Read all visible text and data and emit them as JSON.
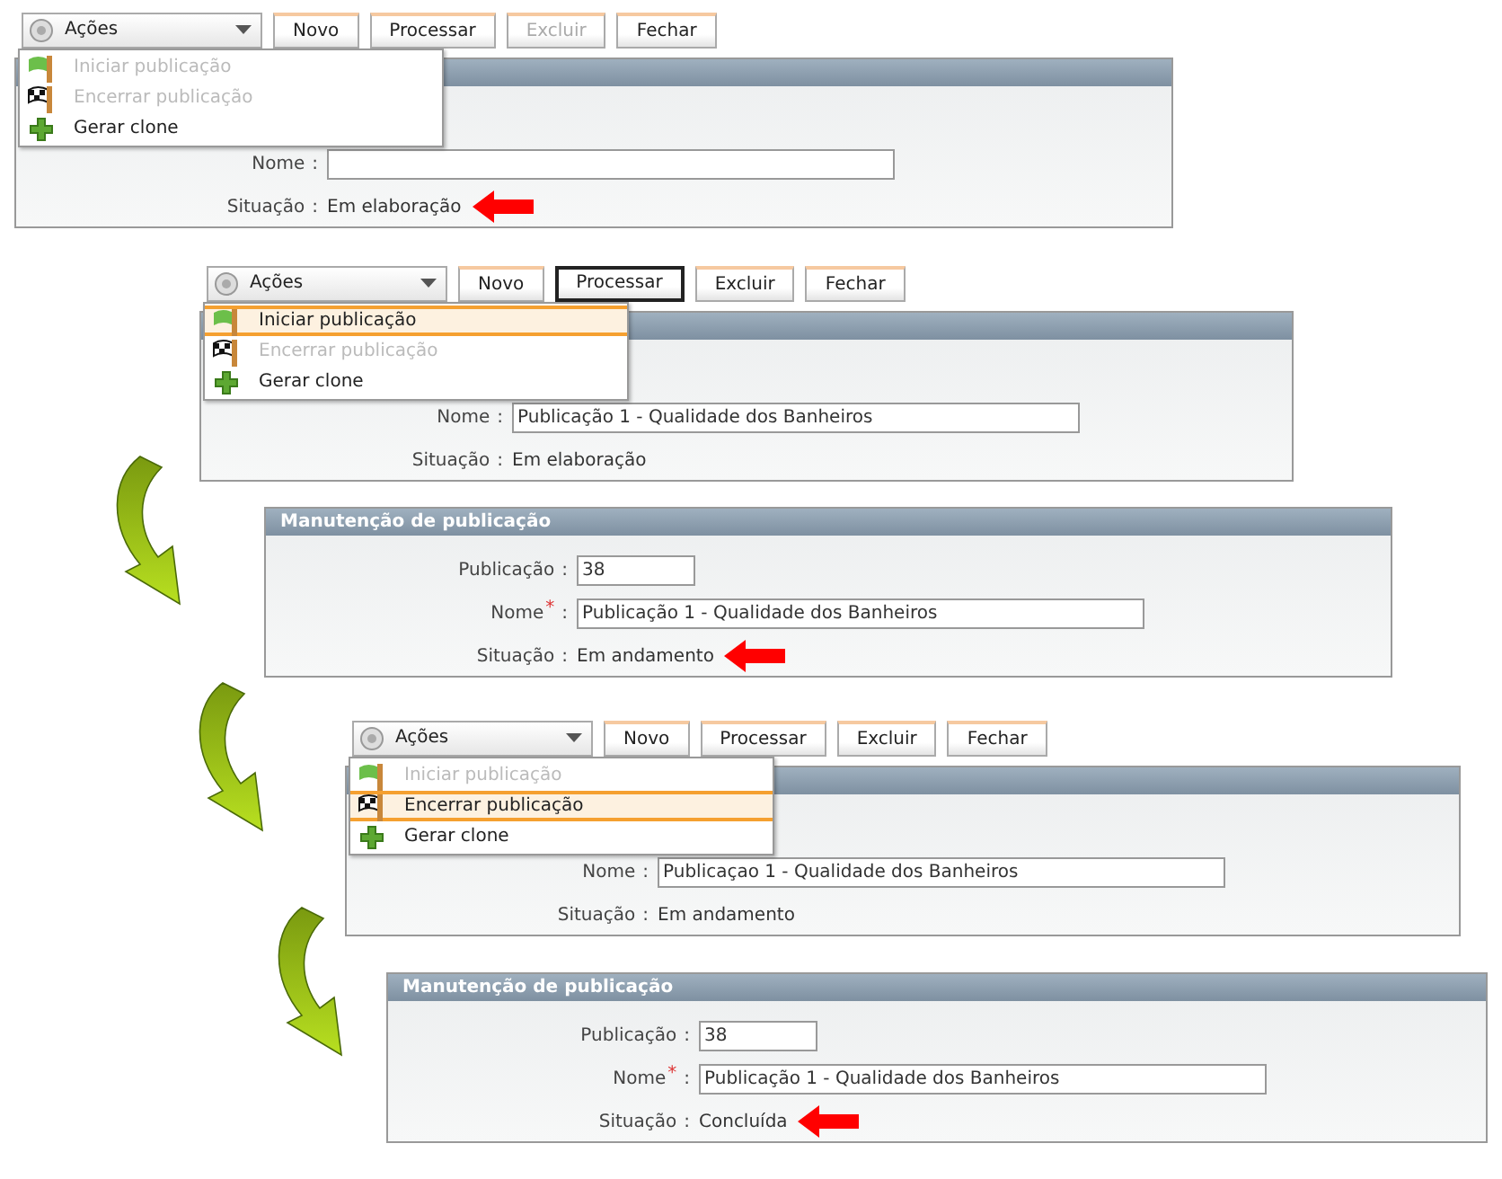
{
  "snippets": [
    {
      "kind": "actions",
      "toolbar": {
        "menu_label": "Ações",
        "buttons": [
          {
            "label": "Novo",
            "disabled": false,
            "focused": false
          },
          {
            "label": "Processar",
            "disabled": false,
            "focused": false
          },
          {
            "label": "Excluir",
            "disabled": true,
            "focused": false
          },
          {
            "label": "Fechar",
            "disabled": false,
            "focused": false
          }
        ],
        "menu": [
          {
            "kind": "start",
            "label": "Iniciar publicação",
            "disabled": true,
            "selected": false
          },
          {
            "kind": "finish",
            "label": "Encerrar publicação",
            "disabled": true,
            "selected": false
          },
          {
            "kind": "clone",
            "label": "Gerar clone",
            "disabled": false,
            "selected": false
          }
        ]
      },
      "panel": {
        "rows": [
          {
            "kind": "input",
            "label": "Nome",
            "colon": ":"
          },
          {
            "kind": "status",
            "label": "Situação",
            "colon": ":",
            "value": "Em elaboração"
          }
        ]
      },
      "highlight": true
    },
    {
      "kind": "actions",
      "toolbar": {
        "menu_label": "Ações",
        "buttons": [
          {
            "label": "Novo",
            "disabled": false,
            "focused": false
          },
          {
            "label": "Processar",
            "disabled": false,
            "focused": true
          },
          {
            "label": "Excluir",
            "disabled": false,
            "focused": false
          },
          {
            "label": "Fechar",
            "disabled": false,
            "focused": false
          }
        ],
        "menu": [
          {
            "kind": "start",
            "label": "Iniciar publicação",
            "disabled": false,
            "selected": true
          },
          {
            "kind": "finish",
            "label": "Encerrar publicação",
            "disabled": true,
            "selected": false
          },
          {
            "kind": "clone",
            "label": "Gerar clone",
            "disabled": false,
            "selected": false
          }
        ]
      },
      "panel": {
        "rows": [
          {
            "kind": "input",
            "label": "Nome",
            "colon": ":",
            "value": "Publicação 1 - Qualidade dos Banheiros"
          },
          {
            "kind": "status",
            "label": "Situação",
            "colon": ":",
            "value": "Em elaboração"
          }
        ]
      },
      "highlight": false
    },
    {
      "kind": "form",
      "panel": {
        "title": "Manutenção de publicação",
        "rows": [
          {
            "kind": "short-input",
            "label": "Publicação",
            "colon": ":",
            "value": "38"
          },
          {
            "kind": "input",
            "label": "Nome",
            "required_mark": "*",
            "colon": ":",
            "value": "Publicação 1 - Qualidade dos Banheiros"
          },
          {
            "kind": "status",
            "label": "Situação",
            "colon": ":",
            "value": "Em andamento"
          }
        ]
      },
      "highlight": true
    },
    {
      "kind": "actions",
      "toolbar": {
        "menu_label": "Ações",
        "buttons": [
          {
            "label": "Novo",
            "disabled": false,
            "focused": false
          },
          {
            "label": "Processar",
            "disabled": false,
            "focused": false
          },
          {
            "label": "Excluir",
            "disabled": false,
            "focused": false
          },
          {
            "label": "Fechar",
            "disabled": false,
            "focused": false
          }
        ],
        "menu": [
          {
            "kind": "start",
            "label": "Iniciar publicação",
            "disabled": true,
            "selected": false
          },
          {
            "kind": "finish",
            "label": "Encerrar publicação",
            "disabled": false,
            "selected": true
          },
          {
            "kind": "clone",
            "label": "Gerar clone",
            "disabled": false,
            "selected": false
          }
        ]
      },
      "panel": {
        "rows": [
          {
            "kind": "input",
            "label": "Nome",
            "colon": ":",
            "value": "Publicaçao 1 - Qualidade dos Banheiros"
          },
          {
            "kind": "status",
            "label": "Situação",
            "colon": ":",
            "value": "Em andamento"
          }
        ]
      },
      "highlight": false
    },
    {
      "kind": "form",
      "panel": {
        "title": "Manutenção de publicação",
        "rows": [
          {
            "kind": "short-input",
            "label": "Publicação",
            "colon": ":",
            "value": "38"
          },
          {
            "kind": "input",
            "label": "Nome",
            "required_mark": "*",
            "colon": ":",
            "value": "Publicação 1 - Qualidade dos Banheiros"
          },
          {
            "kind": "status",
            "label": "Situação",
            "colon": ":",
            "value": "Concluída"
          }
        ]
      },
      "highlight": true
    }
  ]
}
